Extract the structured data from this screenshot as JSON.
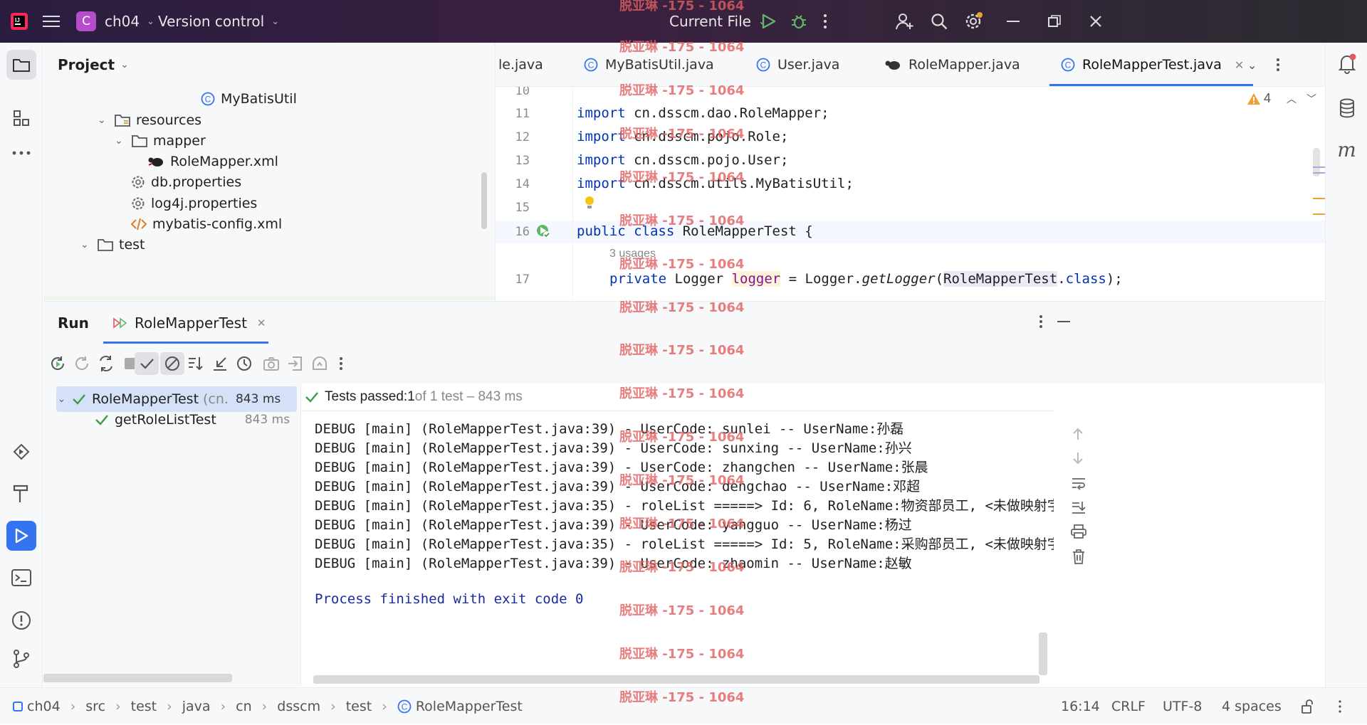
{
  "titlebar": {
    "project_badge": "C",
    "project_name": "ch04",
    "vcs_label": "Version control",
    "run_config": "Current File"
  },
  "project_panel": {
    "title": "Project",
    "tree": [
      {
        "label": "MyBatisUtil",
        "icon": "class-icon"
      },
      {
        "label": "resources",
        "icon": "resources-folder-icon"
      },
      {
        "label": "mapper",
        "icon": "folder-icon"
      },
      {
        "label": "RoleMapper.xml",
        "icon": "mybatis-xml-icon"
      },
      {
        "label": "db.properties",
        "icon": "properties-icon"
      },
      {
        "label": "log4j.properties",
        "icon": "properties-icon"
      },
      {
        "label": "mybatis-config.xml",
        "icon": "xml-icon"
      },
      {
        "label": "test",
        "icon": "folder-icon"
      }
    ]
  },
  "editor": {
    "tabs": [
      {
        "label": "le.java"
      },
      {
        "label": "MyBatisUtil.java"
      },
      {
        "label": "User.java"
      },
      {
        "label": "RoleMapper.java"
      },
      {
        "label": "RoleMapperTest.java"
      }
    ],
    "warning_count": "4",
    "lines": [
      {
        "no": "10"
      },
      {
        "no": "11",
        "kw": "import",
        "rest": " cn.dsscm.dao.RoleMapper;"
      },
      {
        "no": "12",
        "kw": "import",
        "rest": " cn.dsscm.pojo.Role;"
      },
      {
        "no": "13",
        "kw": "import",
        "rest": " cn.dsscm.pojo.User;"
      },
      {
        "no": "14",
        "kw": "import",
        "rest": " cn.dsscm.utils.MyBatisUtil;"
      },
      {
        "no": "15"
      },
      {
        "no": "16",
        "kw": "public class",
        "rest": " RoleMapperTest {"
      },
      {
        "no": "17"
      }
    ],
    "usages_hint": "3 usages",
    "line17": {
      "kw": "private",
      "type": " Logger ",
      "field": "logger",
      "eq": " = Logger.",
      "method": "getLogger",
      "open": "(",
      "arg": "RoleMapperTest",
      "dot": ".",
      "cls_kw": "class",
      "close": ");"
    }
  },
  "run_panel": {
    "title": "Run",
    "tab_label": "RoleMapperTest",
    "tests": [
      {
        "name": "RoleMapperTest",
        "suffix": "(cn.",
        "time": "843 ms"
      },
      {
        "name": "getRoleListTest",
        "time": "843 ms"
      }
    ],
    "summary_prefix": "Tests passed: ",
    "summary_count": "1",
    "summary_rest": " of 1 test – 843 ms",
    "console_lines": [
      "DEBUG [main] (RoleMapperTest.java:39) - UserCode: sunlei -- UserName:孙磊",
      "DEBUG [main] (RoleMapperTest.java:39) - UserCode: sunxing -- UserName:孙兴",
      "DEBUG [main] (RoleMapperTest.java:39) - UserCode: zhangchen -- UserName:张晨",
      "DEBUG [main] (RoleMapperTest.java:39) - UserCode: dengchao -- UserName:邓超",
      "DEBUG [main] (RoleMapperTest.java:35) - roleList =====> Id: 6, RoleName:物资部员工, <未做映射字段>roleCode: DSSCM_MATER",
      "DEBUG [main] (RoleMapperTest.java:39) - UserCode: yangguo -- UserName:杨过",
      "DEBUG [main] (RoleMapperTest.java:35) - roleList =====> Id: 5, RoleName:采购部员工, <未做映射字段>roleCode: DSSCM_PURCH",
      "DEBUG [main] (RoleMapperTest.java:39) - UserCode: zhaomin -- UserName:赵敏"
    ],
    "process_line": "Process finished with exit code 0"
  },
  "statusbar": {
    "breadcrumbs": [
      "ch04",
      "src",
      "test",
      "java",
      "cn",
      "dsscm",
      "test",
      "RoleMapperTest"
    ],
    "position": "16:14",
    "line_sep": "CRLF",
    "encoding": "UTF-8",
    "indent": "4 spaces"
  },
  "watermark": "脱亚琳 -175 - 1064",
  "colors": {
    "accent": "#3574f0",
    "keyword": "#0033b3",
    "pass": "#3d9c4a"
  }
}
